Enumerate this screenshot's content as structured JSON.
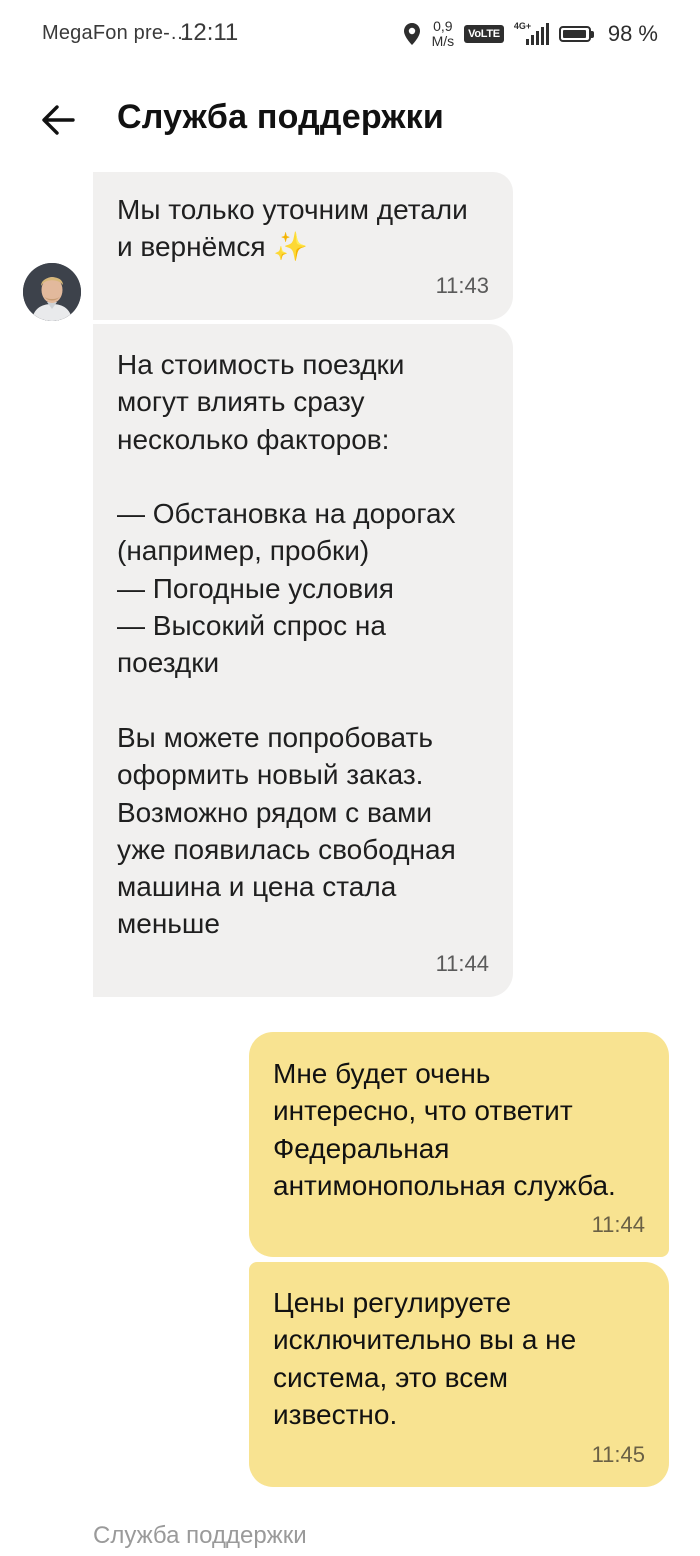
{
  "status_bar": {
    "carrier": "MegaFon pre-…",
    "time": "12:11",
    "speed_value": "0,9",
    "speed_unit": "M/s",
    "volte": "VoLTE",
    "network": "4G+",
    "battery_percent": "98 %",
    "battery_level": 0.98
  },
  "header": {
    "title": "Служба поддержки"
  },
  "messages": [
    {
      "direction": "incoming",
      "text": "Мы только уточним детали\nи вернёмся ✨",
      "time": "11:43"
    },
    {
      "direction": "incoming",
      "text": "На стоимость поездки\nмогут влиять сразу\nнесколько факторов:\n\n— Обстановка на дорогах\n(например, пробки)\n— Погодные условия\n— Высокий спрос на\nпоездки\n\nВы можете попробовать\nоформить новый заказ.\nВозможно рядом с вами\nуже появилась свободная\nмашина и цена стала\nменьше",
      "time": "11:44"
    },
    {
      "direction": "outgoing",
      "text": "Мне будет очень\nинтересно, что ответит\nФедеральная\nантимонопольная служба.",
      "time": "11:44"
    },
    {
      "direction": "outgoing",
      "text": "Цены регулируете\nисключительно вы а не\nсистема, это всем\nизвестно.",
      "time": "11:45"
    }
  ],
  "footer": {
    "sender_label": "Служба поддержки"
  },
  "colors": {
    "incoming_bubble": "#f1f0ef",
    "outgoing_bubble": "#f8e391",
    "meta_text": "#9a9a9a"
  }
}
